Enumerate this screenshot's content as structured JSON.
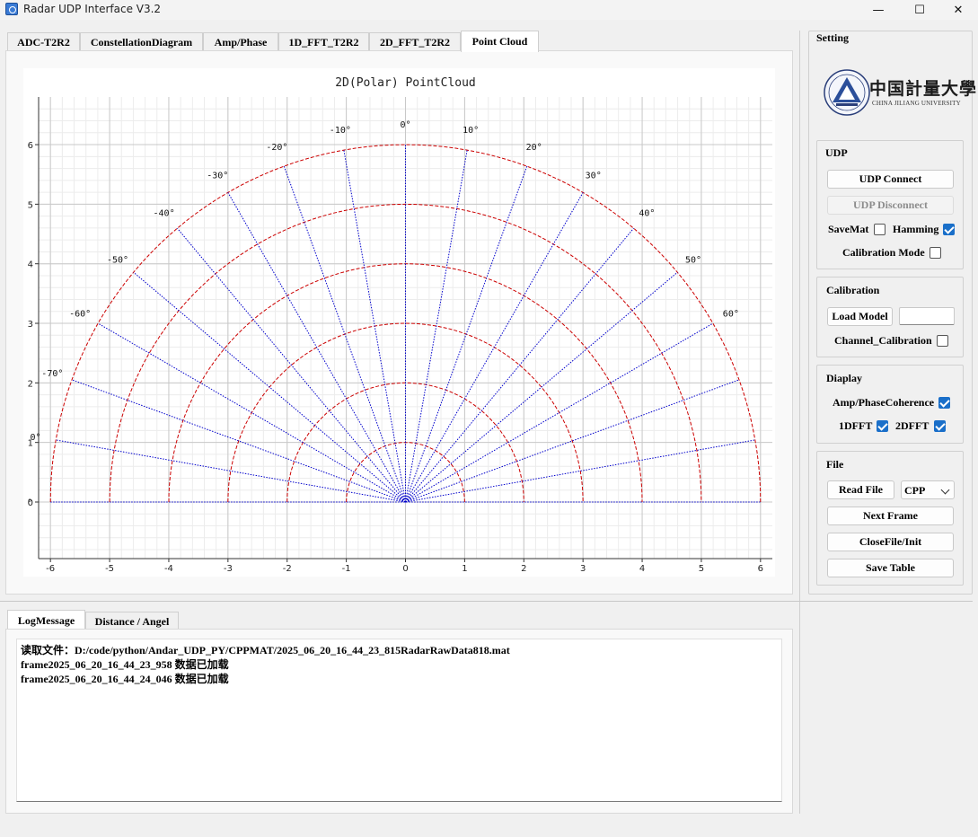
{
  "window": {
    "title": "Radar UDP Interface V3.2",
    "minimize_glyph": "—",
    "maximize_glyph": "☐",
    "close_glyph": "✕"
  },
  "tabs": [
    {
      "label": "ADC-T2R2",
      "active": false
    },
    {
      "label": "ConstellationDiagram",
      "active": false
    },
    {
      "label": "Amp/Phase",
      "active": false
    },
    {
      "label": "1D_FFT_T2R2",
      "active": false
    },
    {
      "label": "2D_FFT_T2R2",
      "active": false
    },
    {
      "label": "Point Cloud",
      "active": true
    }
  ],
  "chart_data": {
    "type": "scatter",
    "title": "2D(Polar) PointCloud",
    "xlim": [
      -6.2,
      6.2
    ],
    "ylim": [
      -0.95,
      6.8
    ],
    "xticks": [
      "-6",
      "-5",
      "-4",
      "-3",
      "-2",
      "-1",
      "0",
      "1",
      "2",
      "3",
      "4",
      "5",
      "6"
    ],
    "yticks": [
      "0",
      "1",
      "2",
      "3",
      "4",
      "5",
      "6"
    ],
    "range_rings": [
      1,
      2,
      3,
      4,
      5,
      6
    ],
    "angle_lines_deg": [
      -80,
      -70,
      -60,
      -50,
      -40,
      -30,
      -20,
      -10,
      0,
      10,
      20,
      30,
      40,
      50,
      60,
      70,
      80
    ],
    "angle_labels": [
      {
        "deg": 0,
        "text": "0°"
      },
      {
        "deg": -10,
        "text": "-10°"
      },
      {
        "deg": 10,
        "text": "10°"
      },
      {
        "deg": -20,
        "text": "-20°"
      },
      {
        "deg": 20,
        "text": "20°"
      },
      {
        "deg": -30,
        "text": "-30°"
      },
      {
        "deg": 30,
        "text": "30°"
      },
      {
        "deg": -40,
        "text": "-40°"
      },
      {
        "deg": 40,
        "text": "40°"
      },
      {
        "deg": -50,
        "text": "-50°"
      },
      {
        "deg": 50,
        "text": "50°"
      },
      {
        "deg": -60,
        "text": "-60°"
      },
      {
        "deg": 60,
        "text": "60°"
      },
      {
        "deg": -70,
        "text": "-70°"
      },
      {
        "deg": -80,
        "text": "0°"
      },
      {
        "deg": -90,
        "text": "°"
      }
    ],
    "grid": true,
    "minor_grid": true,
    "ring_color": "#cc0000",
    "angle_line_color": "#0000cc",
    "points": []
  },
  "settings": {
    "title": "Setting",
    "logo": {
      "cn": "中国計量大學",
      "en": "CHINA JILIANG UNIVERSITY"
    },
    "udp": {
      "title": "UDP",
      "connect_label": "UDP Connect",
      "disconnect_label": "UDP Disconnect",
      "savemat_label": "SaveMat",
      "hamming_label": "Hamming",
      "calibration_mode_label": "Calibration Mode"
    },
    "calibration": {
      "title": "Calibration",
      "load_model_label": "Load Model",
      "channel_calibration_label": "Channel_Calibration"
    },
    "display": {
      "title": "Diaplay",
      "amp_phase_label": "Amp/PhaseCoherence",
      "fft1d_label": "1DFFT",
      "fft2d_label": "2DFFT"
    },
    "file": {
      "title": "File",
      "read_file_label": "Read File",
      "format_value": "CPP",
      "next_frame_label": "Next Frame",
      "close_file_label": "CloseFile/Init",
      "save_table_label": "Save Table"
    }
  },
  "log": {
    "tabs": [
      {
        "label": "LogMessage",
        "active": true
      },
      {
        "label": "Distance / Angel",
        "active": false
      }
    ],
    "lines": [
      "读取文件：D:/code/python/Andar_UDP_PY/CPPMAT/2025_06_20_16_44_23_815RadarRawData818.mat",
      "frame2025_06_20_16_44_23_958 数据已加载",
      "frame2025_06_20_16_44_24_046 数据已加载"
    ]
  }
}
